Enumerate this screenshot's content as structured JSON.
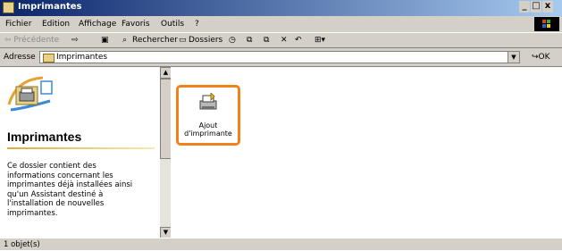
{
  "window": {
    "title": "Imprimantes",
    "controls": {
      "minimize": "_",
      "maximize": "□",
      "close": "x"
    }
  },
  "menu": [
    "Fichier",
    "Edition",
    "Affichage",
    "Favoris",
    "Outils",
    "?"
  ],
  "toolbar": {
    "back": "⇦ Précédente",
    "forward": "⇨",
    "up": "▣",
    "search": "Rechercher",
    "folders": "Dossiers",
    "views": "⊞▾"
  },
  "address": {
    "label": "Adresse",
    "value": "Imprimantes",
    "go": "OK"
  },
  "leftpane": {
    "title": "Imprimantes",
    "description": "Ce dossier contient des\ninformations concernant les\nimprimantes déjà installées ainsi\nqu'un Assistant destiné à\nl'installation de nouvelles\nimprimantes."
  },
  "items": [
    {
      "label": "Ajout d'imprimante",
      "icon": "add-printer-icon"
    }
  ],
  "status": {
    "text": "1 objet(s)"
  },
  "colors": {
    "highlight": "#f0821e",
    "titlebar_start": "#0a246a",
    "titlebar_end": "#a6caf0"
  }
}
